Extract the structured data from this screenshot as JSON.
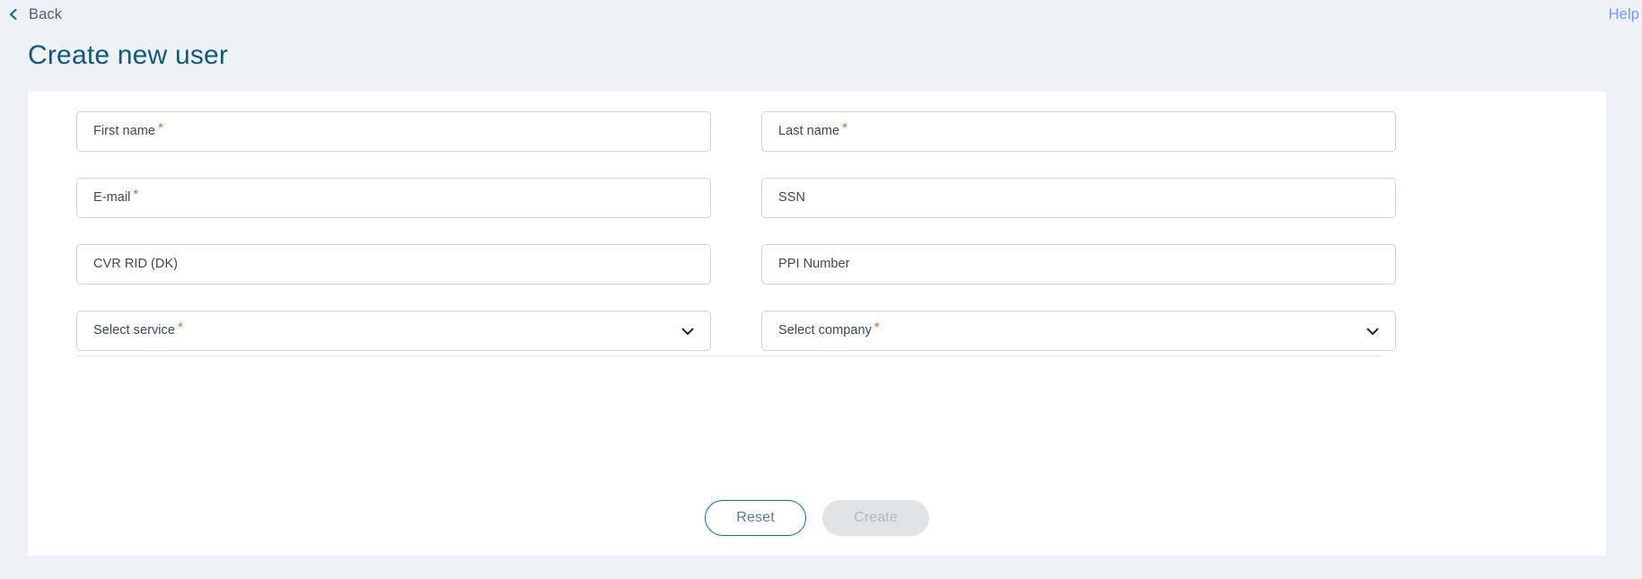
{
  "topbar": {
    "back_label": "Back",
    "back_icon": "chevron-left-icon",
    "help_label": "Help"
  },
  "page": {
    "title": "Create new user"
  },
  "colors": {
    "page_background": "#eef1f8",
    "card_background": "#ffffff",
    "title": "#0d5a7a",
    "back_text": "#51606e",
    "back_icon": "#0a6e93",
    "help_link": "#6e9cf4",
    "field_border": "#cfd3d8",
    "field_label": "#3d4852",
    "required_asterisk": "#c2703f",
    "divider": "#e4e6e9",
    "reset_border": "#0b7397",
    "reset_text": "#5b7a91",
    "create_background": "#e2e3e5",
    "create_text": "#b5b7ba"
  },
  "form": {
    "rows": [
      {
        "left": {
          "name": "first-name",
          "label": "First name",
          "required": true,
          "type": "text",
          "value": "",
          "placeholder": "First name"
        },
        "right": {
          "name": "last-name",
          "label": "Last name",
          "required": true,
          "type": "text",
          "value": "",
          "placeholder": "Last name"
        }
      },
      {
        "left": {
          "name": "email",
          "label": "E-mail",
          "required": true,
          "type": "text",
          "value": "",
          "placeholder": "E-mail"
        },
        "right": {
          "name": "ssn",
          "label": "SSN",
          "required": false,
          "type": "text",
          "value": "",
          "placeholder": "SSN"
        }
      },
      {
        "left": {
          "name": "cvr-rid-dk",
          "label": "CVR RID (DK)",
          "required": false,
          "type": "text",
          "value": "",
          "placeholder": "CVR RID (DK)"
        },
        "right": {
          "name": "ppi-number",
          "label": "PPI Number",
          "required": false,
          "type": "text",
          "value": "",
          "placeholder": "PPI Number"
        }
      },
      {
        "left": {
          "name": "select-service",
          "label": "Select service",
          "required": true,
          "type": "select",
          "value": "",
          "icon": "chevron-down-icon"
        },
        "right": {
          "name": "select-company",
          "label": "Select company",
          "required": true,
          "type": "select",
          "value": "",
          "icon": "chevron-down-icon"
        }
      }
    ]
  },
  "actions": {
    "reset_label": "Reset",
    "create_label": "Create",
    "create_disabled": true
  }
}
